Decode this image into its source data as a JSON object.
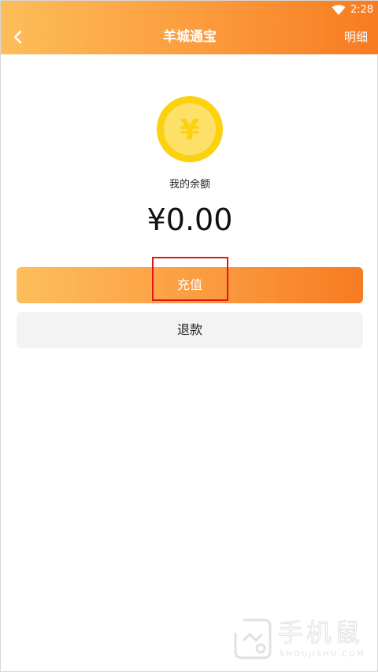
{
  "status_bar": {
    "time": "2:28",
    "wifi_icon": "wifi-icon"
  },
  "header": {
    "back_icon": "chevron-left-icon",
    "title": "羊城通宝",
    "detail_label": "明细"
  },
  "wallet": {
    "coin_icon": "yuan-coin-icon",
    "coin_symbol": "¥",
    "balance_label": "我的余额",
    "balance_amount": "¥0.00"
  },
  "actions": {
    "recharge_label": "充值",
    "refund_label": "退款"
  },
  "watermark": {
    "title": "手机鼠",
    "subtitle": "SHOUJISHU.COM"
  },
  "colors": {
    "header_gradient_start": "#fdbd5a",
    "header_gradient_end": "#f77b22",
    "coin": "#fcd10f",
    "refund_background": "#f3f3f3",
    "highlight": "#e0161c"
  }
}
